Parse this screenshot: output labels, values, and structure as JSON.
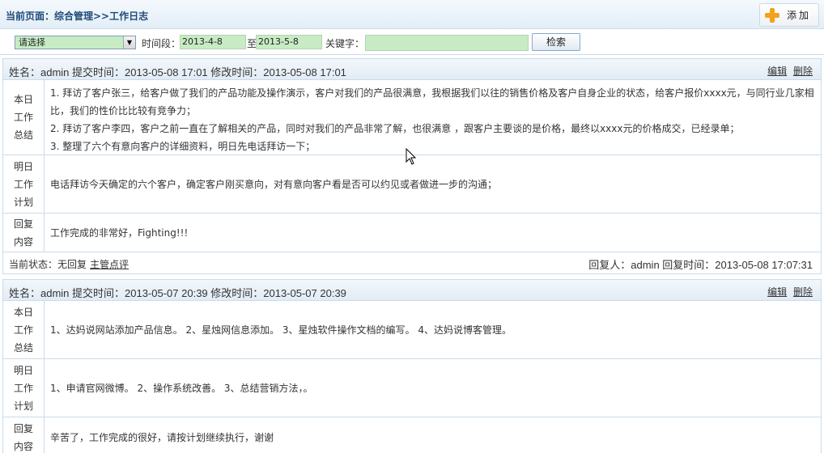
{
  "header": {
    "title": "当前页面：综合管理>>工作日志",
    "add_label": "添加"
  },
  "toolbar": {
    "select_value": "请选择",
    "time_label": "时间段：",
    "date_from": "2013-4-8",
    "to_label": "至",
    "date_to": "2013-5-8",
    "keyword_label": "关键字：",
    "keyword_value": "",
    "search_label": "检索"
  },
  "entries": [
    {
      "meta": "姓名：admin 提交时间：2013-05-08 17:01  修改时间：2013-05-08 17:01",
      "edit": "编辑",
      "delete": "删除",
      "today_label": [
        "本日",
        "工作",
        "总结"
      ],
      "today": [
        "1. 拜访了客户张三，给客户做了我们的产品功能及操作演示，客户对我们的产品很满意，我根据我们以往的销售价格及客户自身企业的状态，给客户报价xxxx元，与同行业几家相比，我们的性价比比较有竞争力；",
        "2. 拜访了客户李四，客户之前一直在了解相关的产品，同时对我们的产品非常了解，也很满意 ，跟客户主要谈的是价格，最终以xxxx元的价格成交，已经录单；",
        "3. 整理了六个有意向客户的详细资料，明日先电话拜访一下；"
      ],
      "plan_label": [
        "明日",
        "工作",
        "计划"
      ],
      "plan": "电话拜访今天确定的六个客户，确定客户刚买意向，对有意向客户看是否可以约见或者做进一步的沟通；",
      "reply_label": [
        "回复",
        "内容"
      ],
      "reply": "工作完成的非常好，Fighting!!!",
      "status": "当前状态：无回复",
      "review_link": "主管点评",
      "reply_info": "回复人：admin 回复时间：2013-05-08 17:07:31"
    },
    {
      "meta": "姓名：admin 提交时间：2013-05-07 20:39  修改时间：2013-05-07 20:39",
      "edit": "编辑",
      "delete": "删除",
      "today_label": [
        "本日",
        "工作",
        "总结"
      ],
      "today": [
        "1、达妈说网站添加产品信息。 2、星烛网信息添加。 3、星烛软件操作文档的编写。 4、达妈说博客管理。"
      ],
      "plan_label": [
        "明日",
        "工作",
        "计划"
      ],
      "plan": "1、申请官网微博。 2、操作系统改善。 3、总结营销方法，。",
      "reply_label": [
        "回复",
        "内容"
      ],
      "reply": "辛苦了，工作完成的很好，请按计划继续执行，谢谢"
    }
  ],
  "colors": {
    "title": "#1f4a78",
    "input_bg": "#c7ecc4",
    "border": "#c9dbe9",
    "add_icon": "#f4a21a"
  },
  "icons": {
    "add": "plus-icon",
    "dropdown": "chevron-down-icon",
    "cursor": "mouse-pointer-icon"
  }
}
